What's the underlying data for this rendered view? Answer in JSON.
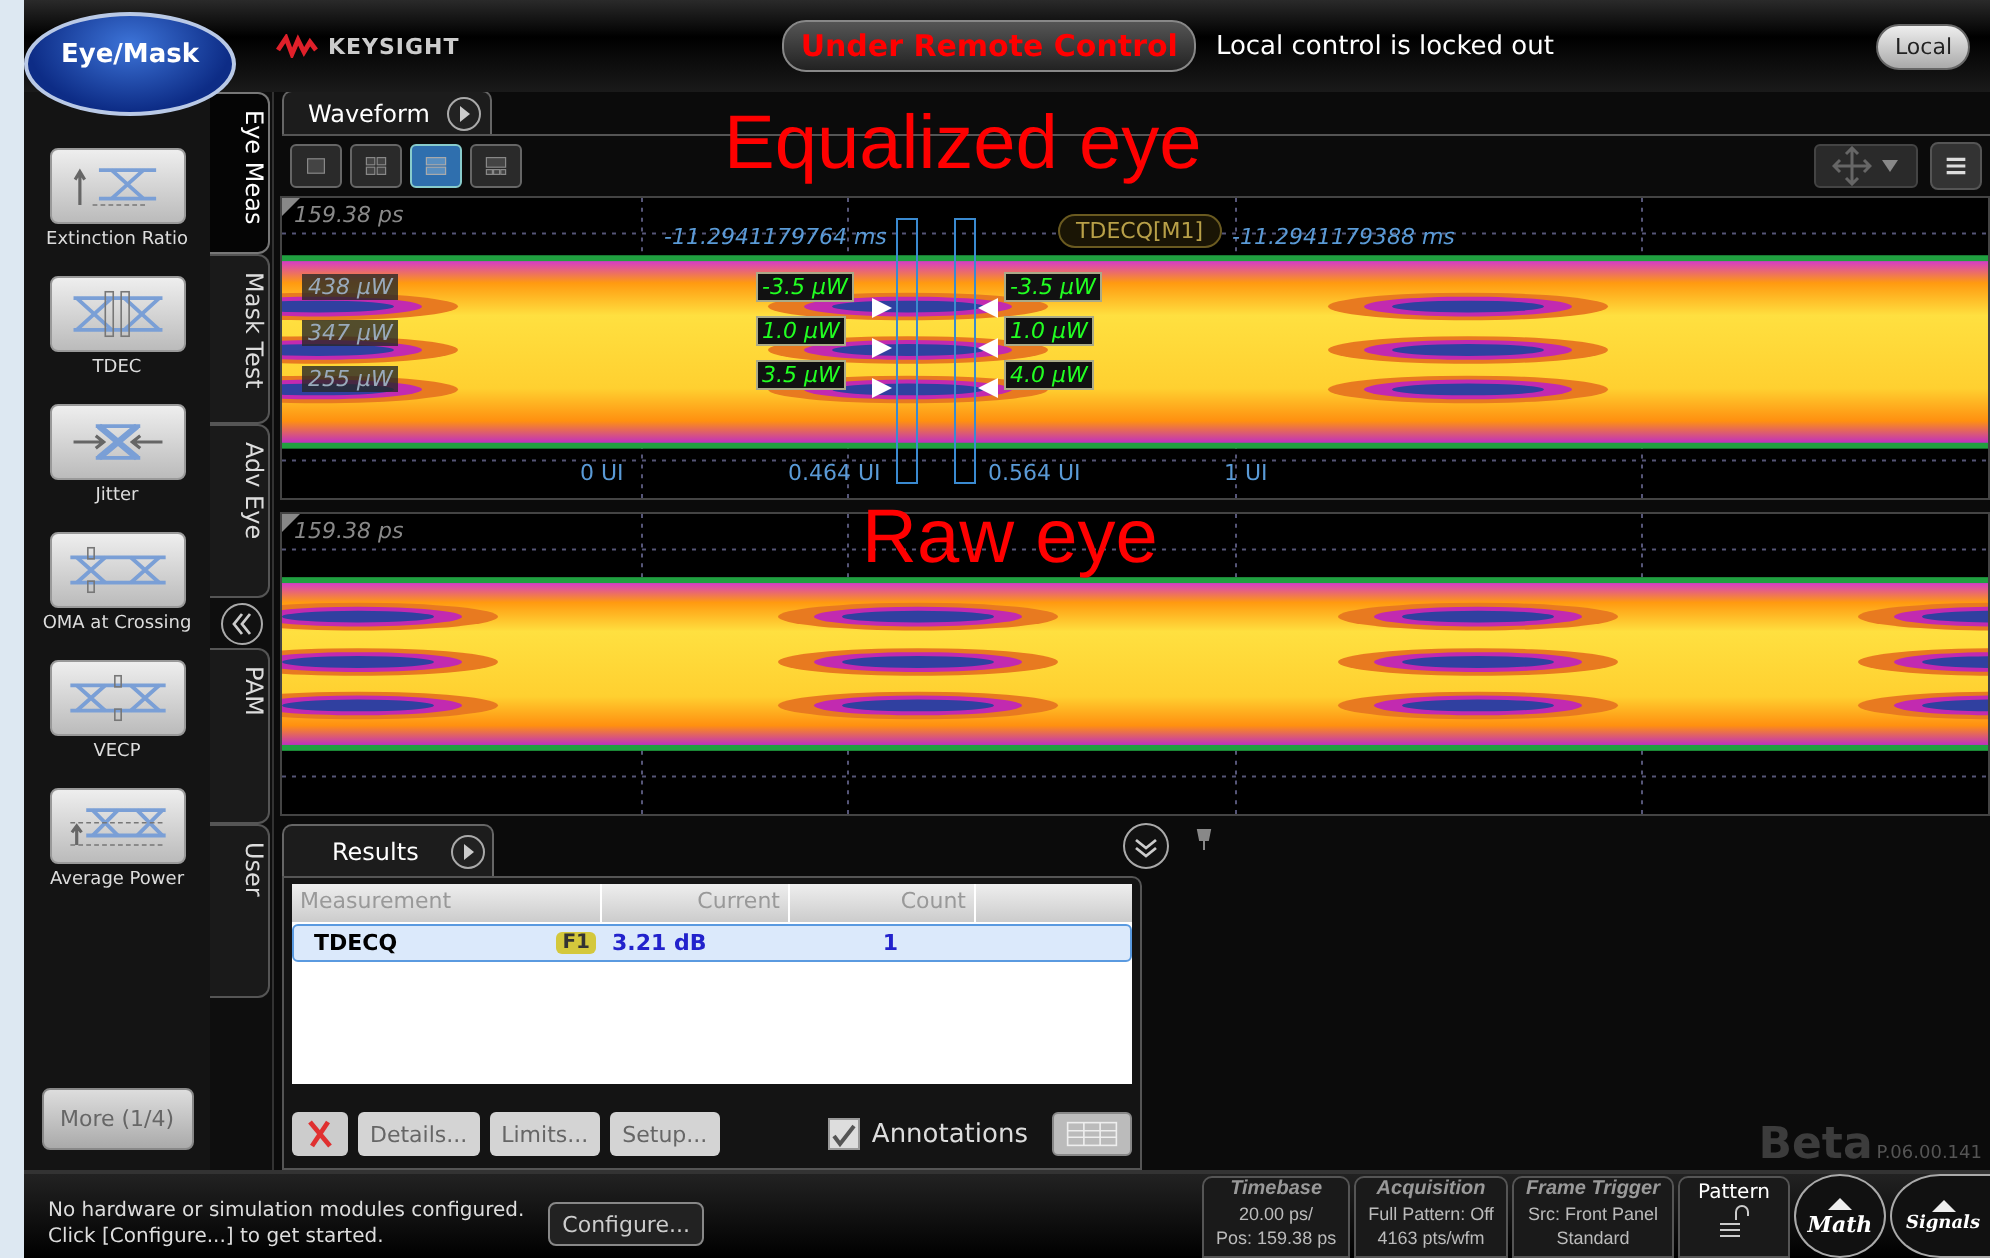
{
  "mode_button": "Eye/Mask",
  "brand": "KEYSIGHT",
  "remote_banner": "Under Remote Control",
  "remote_message": "Local control is locked out",
  "local_button": "Local",
  "measure_buttons": [
    {
      "label": "Extinction Ratio",
      "kind": "extinction"
    },
    {
      "label": "TDEC",
      "kind": "tdec"
    },
    {
      "label": "Jitter",
      "kind": "jitter"
    },
    {
      "label": "OMA at Crossing",
      "kind": "oma"
    },
    {
      "label": "VECP",
      "kind": "vecp"
    },
    {
      "label": "Average Power",
      "kind": "average"
    }
  ],
  "more_button": "More (1/4)",
  "side_tabs": [
    {
      "label": "Eye Meas",
      "selected": true
    },
    {
      "label": "Mask Test",
      "selected": false
    },
    {
      "label": "Adv Eye",
      "selected": false
    },
    {
      "label": "PAM",
      "selected": false
    },
    {
      "label": "User",
      "selected": false
    }
  ],
  "waveform_tab": "Waveform",
  "layout_buttons": [
    {
      "selected": false
    },
    {
      "selected": false
    },
    {
      "selected": true
    },
    {
      "selected": false
    }
  ],
  "plots": [
    {
      "timestamp": "159.38 ps",
      "caption": "Equalized eye",
      "badge": "TDECQ[M1]",
      "time_labels": [
        "-11.2941179764 ms",
        "-11.2941179388 ms"
      ],
      "level_labels": [
        "438 µW",
        "347 µW",
        "255 µW"
      ],
      "left_readings": [
        "-3.5 µW",
        "1.0 µW",
        "3.5 µW"
      ],
      "right_readings": [
        "-3.5 µW",
        "1.0 µW",
        "4.0 µW"
      ],
      "ui_labels": [
        "0 UI",
        "0.464 UI",
        "0.564 UI",
        "1 UI"
      ]
    },
    {
      "timestamp": "159.38 ps",
      "caption": "Raw eye"
    }
  ],
  "results": {
    "tab": "Results",
    "columns": [
      "Measurement",
      "Current",
      "Count"
    ],
    "rows": [
      {
        "measurement": "TDECQ",
        "tag": "F1",
        "current": "3.21 dB",
        "count": "1",
        "selected": true
      }
    ],
    "buttons": [
      {
        "label": "Details...",
        "disabled": true
      },
      {
        "label": "Limits...",
        "disabled": true
      },
      {
        "label": "Setup...",
        "disabled": true
      }
    ],
    "annotations": {
      "label": "Annotations",
      "checked": true
    }
  },
  "version": {
    "beta": "Beta",
    "build": "P.06.00.141"
  },
  "status_bar": {
    "message": [
      "No hardware or simulation modules configured.",
      "Click [Configure...] to get started."
    ],
    "configure_button": "Configure...",
    "panels": [
      {
        "title": "Timebase",
        "lines": [
          "20.00 ps/",
          "Pos: 159.38 ps"
        ]
      },
      {
        "title": "Acquisition",
        "lines": [
          "Full Pattern: Off",
          "4163 pts/wfm"
        ]
      },
      {
        "title": "Frame Trigger",
        "lines": [
          "Src: Front Panel",
          "Standard"
        ]
      }
    ],
    "pattern_button": "Pattern",
    "round_buttons": [
      "Math",
      "Signals"
    ]
  }
}
